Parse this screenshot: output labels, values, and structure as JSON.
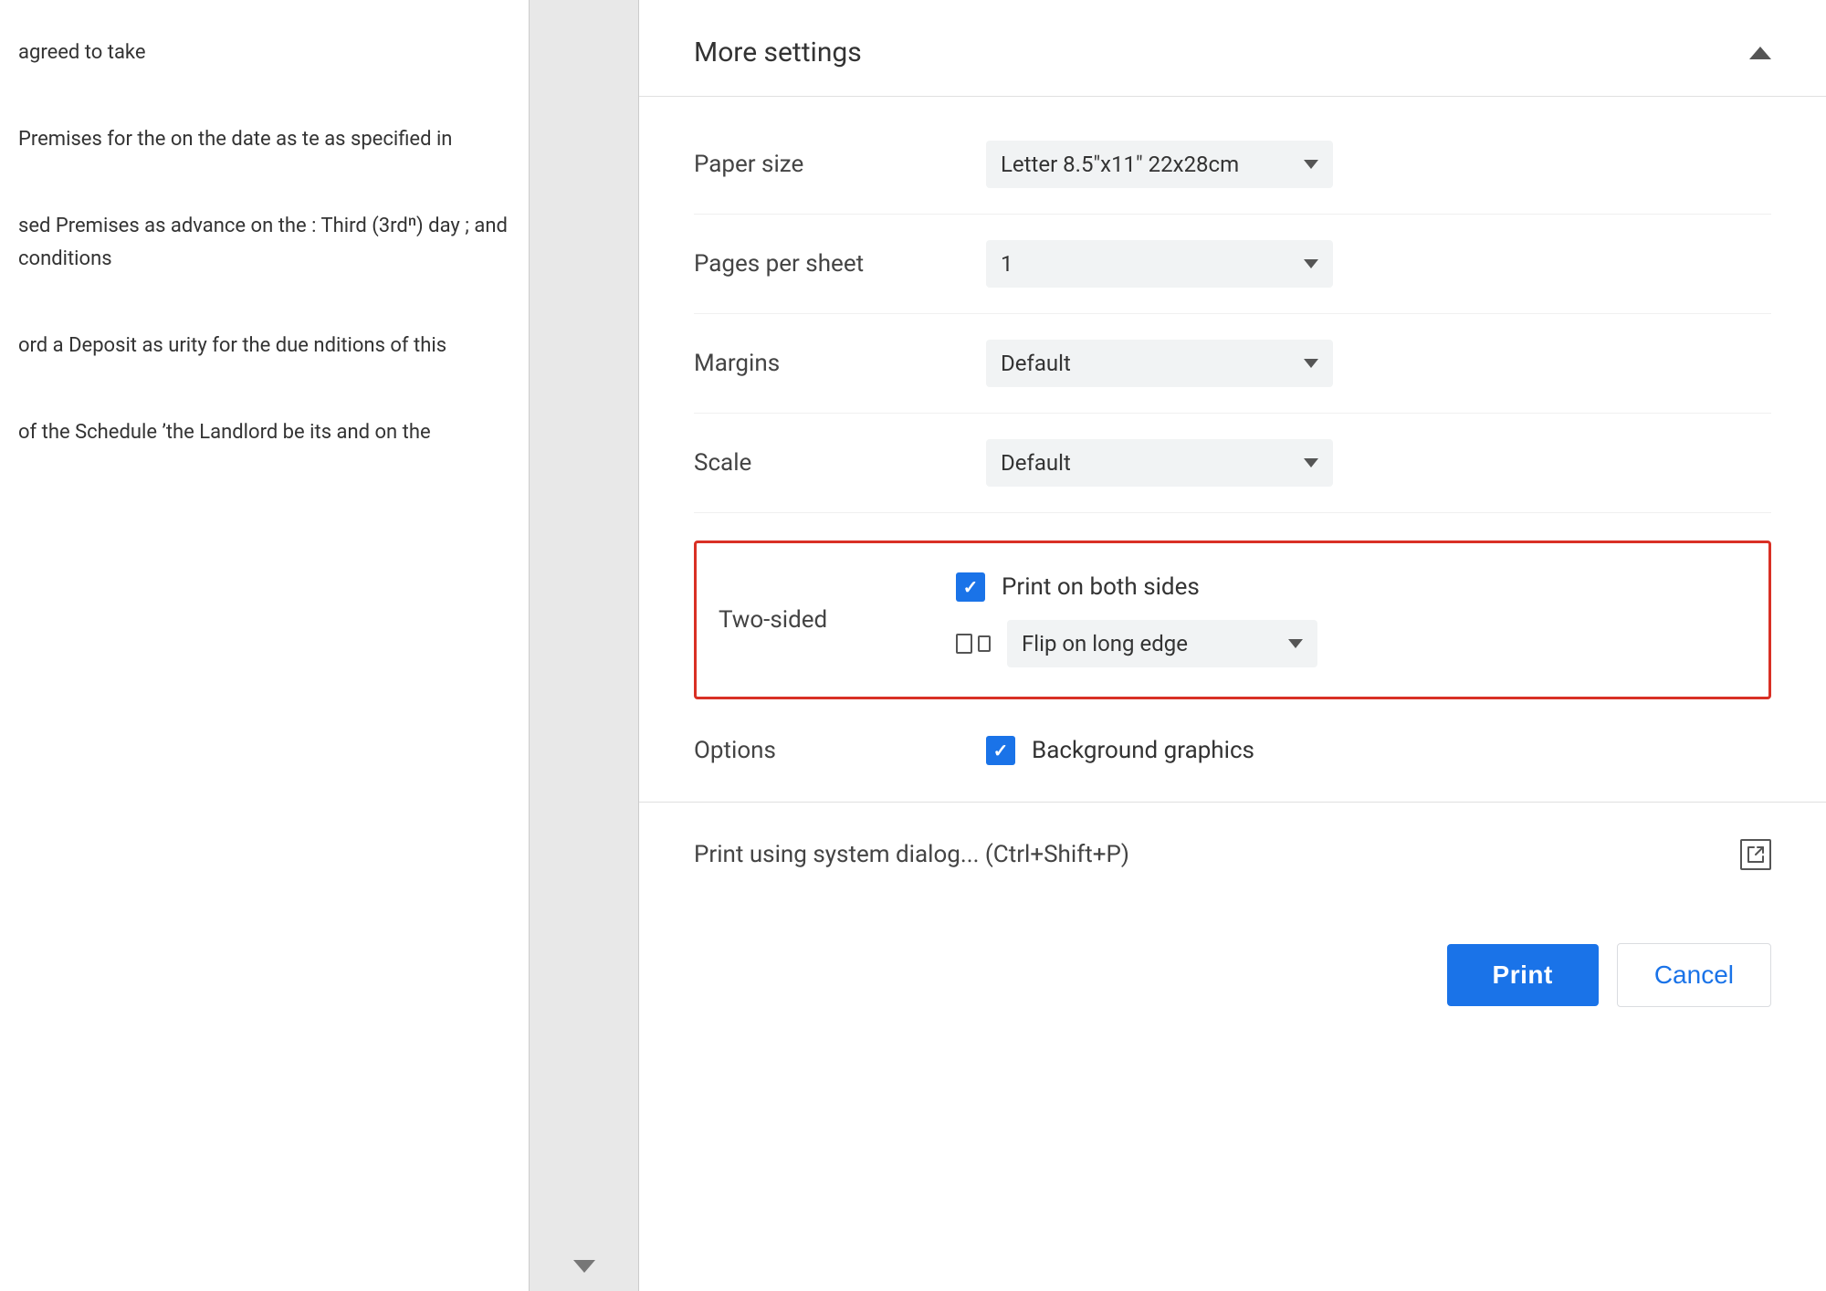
{
  "document": {
    "text_blocks": [
      "agreed to take",
      "Premises for the\n on the date as\nte as specified in",
      "sed Premises as\n advance on the\n: Third (3rdⁿ) day\n; and conditions",
      "ord a Deposit as\nurity for the due\nnditions of this",
      "of the Schedule\nʼthe Landlord be\nits and on the"
    ]
  },
  "print_panel": {
    "more_settings_label": "More settings",
    "paper_size_label": "Paper size",
    "paper_size_value": "Letter 8.5\"x11\" 22x28cm",
    "pages_per_sheet_label": "Pages per sheet",
    "pages_per_sheet_value": "1",
    "margins_label": "Margins",
    "margins_value": "Default",
    "scale_label": "Scale",
    "scale_value": "Default",
    "two_sided_label": "Two-sided",
    "print_both_sides_label": "Print on both sides",
    "flip_on_long_edge_label": "Flip on long edge",
    "options_label": "Options",
    "background_graphics_label": "Background graphics",
    "system_dialog_label": "Print using system dialog... (Ctrl+Shift+P)",
    "print_button_label": "Print",
    "cancel_button_label": "Cancel"
  }
}
